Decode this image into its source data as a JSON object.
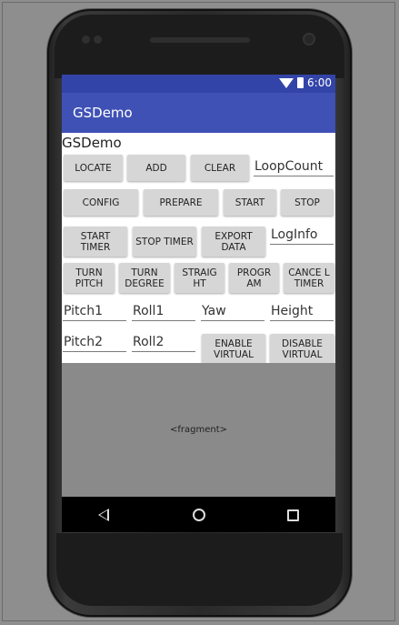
{
  "status": {
    "time": "6:00"
  },
  "appbar": {
    "title": "GSDemo"
  },
  "main": {
    "label": "GSDemo",
    "row1": {
      "locate": "LOCATE",
      "add": "ADD",
      "clear": "CLEAR",
      "loop_count": "LoopCount"
    },
    "row2": {
      "config": "CONFIG",
      "prepare": "PREPARE",
      "start": "START",
      "stop": "STOP"
    },
    "row3": {
      "start_timer": "START TIMER",
      "stop_timer": "STOP TIMER",
      "export_data": "EXPORT DATA",
      "log_info": "LogInfo"
    },
    "row4": {
      "turn_pitch": "TURN PITCH",
      "turn_degree": "TURN DEGREE",
      "straight": "STRAIG HT",
      "program": "PROGR AM",
      "cancel_timer": "CANCE L TIMER"
    },
    "row5": {
      "pitch1": "Pitch1",
      "roll1": "Roll1",
      "yaw": "Yaw",
      "height": "Height"
    },
    "row6": {
      "pitch2": "Pitch2",
      "roll2": "Roll2",
      "enable_virtual": "ENABLE VIRTUAL",
      "disable_virtual": "DISABLE VIRTUAL"
    }
  },
  "fragment": {
    "label": "<fragment>"
  },
  "colors": {
    "statusbar": "#3344a8",
    "appbar": "#3f51b5",
    "button": "#d6d6d6"
  },
  "icons": [
    "wifi-icon",
    "battery-icon",
    "back-icon",
    "home-icon",
    "recents-icon"
  ]
}
